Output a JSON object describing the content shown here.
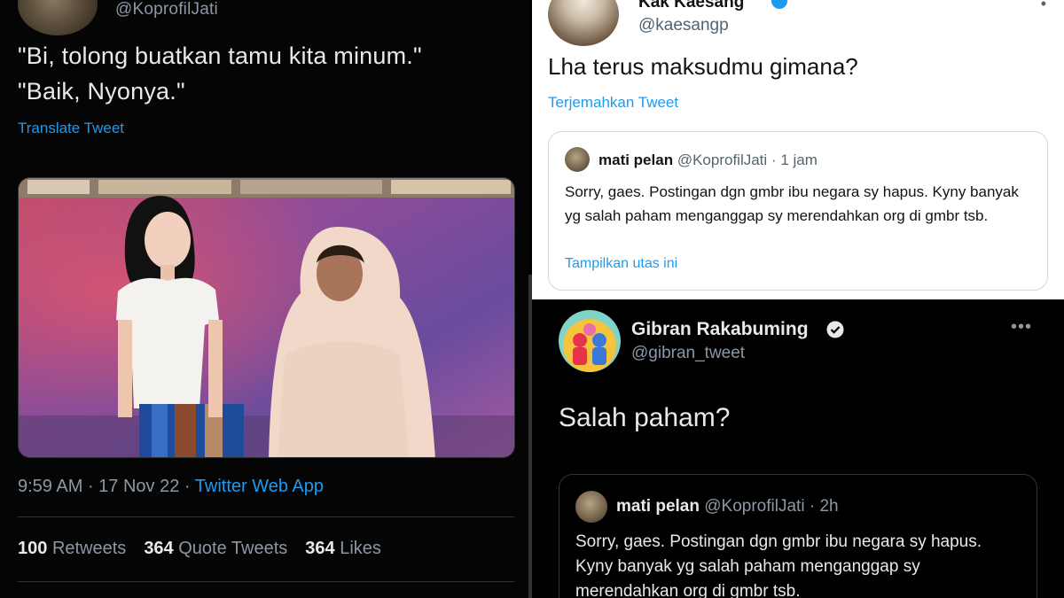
{
  "left_tweet": {
    "handle": "@KoprofilJati",
    "text_line1": "\"Bi, tolong buatkan tamu kita minum.\"",
    "text_line2": "\"Baik, Nyonya.\"",
    "translate_label": "Translate Tweet",
    "time": "9:59 AM",
    "date": "17 Nov 22",
    "source": "Twitter Web App",
    "stats": [
      {
        "count": "100",
        "label": "Retweets"
      },
      {
        "count": "364",
        "label": "Quote Tweets"
      },
      {
        "count": "364",
        "label": "Likes"
      }
    ]
  },
  "top_right_tweet": {
    "name": "Kak Kaesang",
    "handle": "@kaesangp",
    "text": "Lha terus maksudmu gimana?",
    "translate_label": "Terjemahkan Tweet",
    "quote": {
      "name": "mati pelan",
      "handle": "@KoprofilJati",
      "time": "1 jam",
      "body": "Sorry, gaes. Postingan dgn gmbr ibu negara sy hapus. Kyny banyak yg salah paham menganggap sy merendahkan org di gmbr tsb.",
      "thread_label": "Tampilkan utas ini"
    }
  },
  "bottom_right_tweet": {
    "name": "Gibran Rakabuming",
    "handle": "@gibran_tweet",
    "text": "Salah paham?",
    "more_label": "•••",
    "quote": {
      "name": "mati pelan",
      "handle": "@KoprofilJati",
      "time": "2h",
      "body": "Sorry, gaes. Postingan dgn gmbr ibu negara sy hapus. Kyny banyak yg salah paham menganggap sy merendahkan org di gmbr tsb."
    }
  },
  "colors": {
    "link_blue": "#1d9bf0",
    "dark_bg": "#000000",
    "light_bg": "#ffffff"
  }
}
